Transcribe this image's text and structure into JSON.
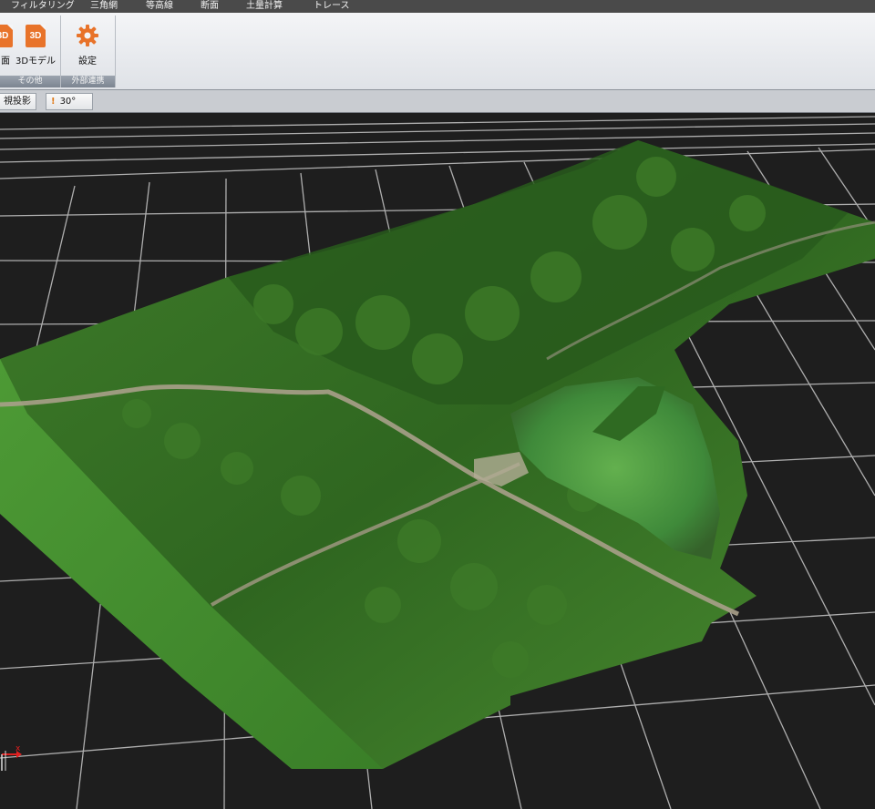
{
  "menu": {
    "items": [
      "フィルタリング",
      "三角網",
      "等高線",
      "断面",
      "土量計算",
      "トレース"
    ]
  },
  "ribbon": {
    "buttons": {
      "cross_section": "面",
      "model_3d": "3Dモデル",
      "model_3d_icon_text": "3D",
      "settings": "設定"
    },
    "groups": {
      "other": "その他",
      "external": "外部連携"
    }
  },
  "viewbar": {
    "projection_label": "視投影",
    "angle": "30°"
  },
  "viewport": {
    "background": "#1e1e1e",
    "grid_color": "#c8c8c8",
    "axis_x_label": "x",
    "axis_x_color": "#e02020"
  },
  "icons": {
    "settings": "gear-icon",
    "model_3d": "3d-document-icon",
    "warning": "warning-icon"
  }
}
